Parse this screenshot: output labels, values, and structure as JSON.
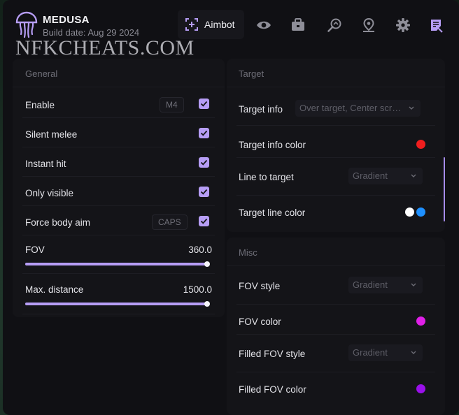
{
  "header": {
    "app_name": "MEDUSA",
    "build_date": "Build date: Aug 29 2024",
    "watermark": "NFKCHEATS.COM",
    "active_tab_label": "Aimbot",
    "tabs": [
      {
        "label": "Aimbot",
        "icon": "crosshair-plus-icon",
        "active": true
      },
      {
        "icon": "eye-icon"
      },
      {
        "icon": "briefcase-icon"
      },
      {
        "icon": "search-magnifier-icon"
      },
      {
        "icon": "map-pin-icon"
      },
      {
        "icon": "gear-icon"
      },
      {
        "icon": "script-list-icon"
      }
    ],
    "accent_color": "#b69df5"
  },
  "general": {
    "title": "General",
    "enable": {
      "label": "Enable",
      "keybind": "M4",
      "checked": true
    },
    "silent_melee": {
      "label": "Silent melee",
      "checked": true
    },
    "instant_hit": {
      "label": "Instant hit",
      "checked": true
    },
    "only_visible": {
      "label": "Only visible",
      "checked": true
    },
    "force_body_aim": {
      "label": "Force body aim",
      "keybind": "CAPS",
      "checked": true
    },
    "fov": {
      "label": "FOV",
      "value": "360.0",
      "fraction": 1.0
    },
    "max_distance": {
      "label": "Max. distance",
      "value": "1500.0",
      "fraction": 1.0
    }
  },
  "target": {
    "title": "Target",
    "target_info": {
      "label": "Target info",
      "value": "Over target, Center screen"
    },
    "target_info_color": {
      "label": "Target info color",
      "color": "#f01e1e"
    },
    "line_to_target": {
      "label": "Line to target",
      "value": "Gradient"
    },
    "target_line_color": {
      "label": "Target line color",
      "colors": [
        "#ffffff",
        "#1e90ff"
      ]
    }
  },
  "misc": {
    "title": "Misc",
    "fov_style": {
      "label": "FOV style",
      "value": "Gradient"
    },
    "fov_color": {
      "label": "FOV color",
      "color": "#e020e8"
    },
    "filled_fov_style": {
      "label": "Filled FOV style",
      "value": "Gradient"
    },
    "filled_fov_color": {
      "label": "Filled FOV color",
      "color": "#9a10ea"
    }
  }
}
